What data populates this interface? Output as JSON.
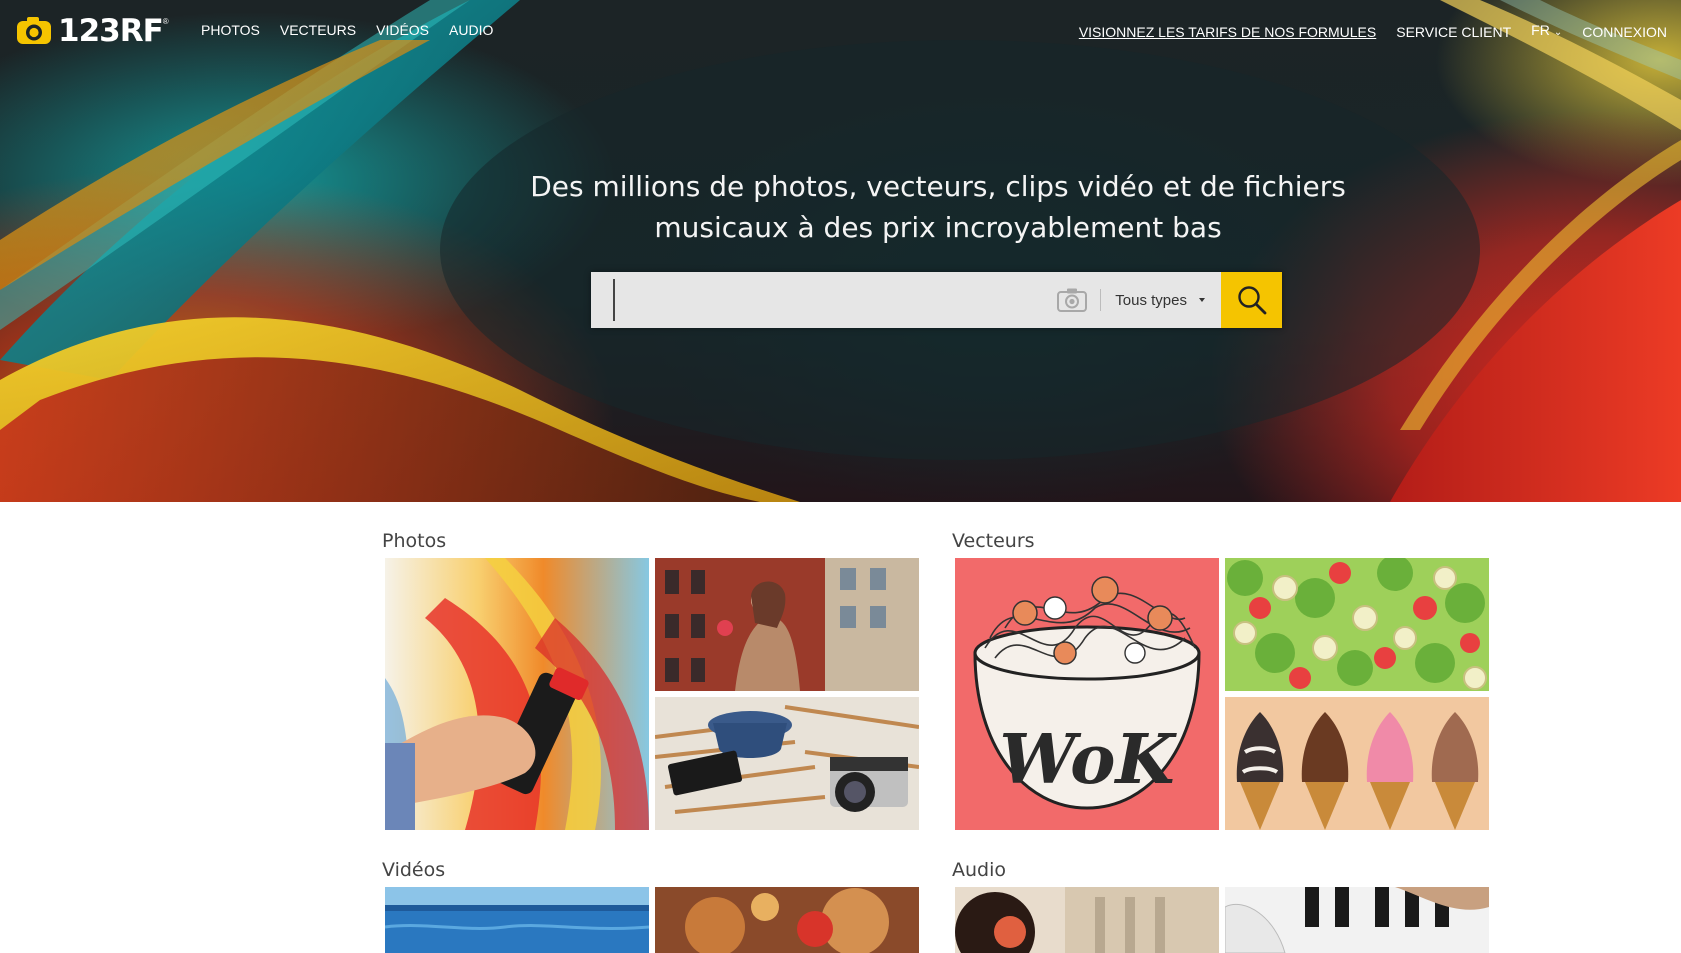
{
  "brand": {
    "logo_text": "123RF",
    "registered_mark": "®"
  },
  "nav": {
    "left": [
      "PHOTOS",
      "VECTEURS",
      "VIDÉOS",
      "AUDIO"
    ],
    "pricing_link": "VISIONNEZ LES TARIFS DE NOS FORMULES",
    "support_link": "SERVICE CLIENT",
    "language": "FR",
    "login": "CONNEXION"
  },
  "hero": {
    "headline_line1": "Des millions de photos, vecteurs, clips vidéo et de fichiers",
    "headline_line2": "musicaux à des prix incroyablement bas"
  },
  "search": {
    "placeholder": "",
    "value": "",
    "type_selected": "Tous types",
    "icons": {
      "camera": "camera-icon",
      "search": "search-icon"
    }
  },
  "sections": {
    "photos": "Photos",
    "vectors": "Vecteurs",
    "videos": "Vidéos",
    "audio": "Audio"
  },
  "colors": {
    "accent": "#f5c400",
    "nav_text": "#ffffff",
    "section_title": "#444444"
  }
}
